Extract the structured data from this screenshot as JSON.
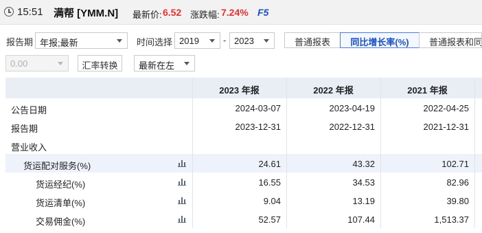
{
  "header": {
    "time": "15:51",
    "stock_name": "满帮 [YMM.N]",
    "price_label": "最新价:",
    "price_value": "6.52",
    "change_label": "涨跌幅:",
    "change_value": "7.24%",
    "refresh_key": "F5",
    "colors": {
      "up": "#e8302f",
      "accent": "#1a4fc4"
    }
  },
  "controls": {
    "period_label": "报告期",
    "period_select": "年报;最新",
    "time_label": "时间选择",
    "year_from": "2019",
    "dash": "-",
    "year_to": "2023",
    "tabs": [
      {
        "label": "普通报表",
        "active": false
      },
      {
        "label": "同比增长率(%)",
        "active": true
      },
      {
        "label": "普通报表和同",
        "active": false
      }
    ],
    "rate_select": "0.00",
    "fx_button": "汇率转换",
    "order_select": "最新在左"
  },
  "table": {
    "columns": [
      "2023 年报",
      "2022 年报",
      "2021 年报"
    ],
    "rows": [
      {
        "name": "公告日期",
        "values": [
          "2024-03-07",
          "2023-04-19",
          "2022-04-25"
        ],
        "chart": false,
        "indent": 0
      },
      {
        "name": "报告期",
        "values": [
          "2023-12-31",
          "2022-12-31",
          "2021-12-31"
        ],
        "chart": false,
        "indent": 0
      },
      {
        "name": "营业收入",
        "values": [
          "",
          "",
          ""
        ],
        "chart": false,
        "indent": 0
      },
      {
        "name": "货运配对服务(%)",
        "values": [
          "24.61",
          "43.32",
          "102.71"
        ],
        "chart": true,
        "indent": 1
      },
      {
        "name": "货运经纪(%)",
        "values": [
          "16.55",
          "34.53",
          "82.96"
        ],
        "chart": true,
        "indent": 2
      },
      {
        "name": "货运清单(%)",
        "values": [
          "9.04",
          "13.19",
          "39.80"
        ],
        "chart": true,
        "indent": 2
      },
      {
        "name": "交易佣金(%)",
        "values": [
          "52.57",
          "107.44",
          "1,513.37"
        ],
        "chart": true,
        "indent": 2
      }
    ]
  }
}
